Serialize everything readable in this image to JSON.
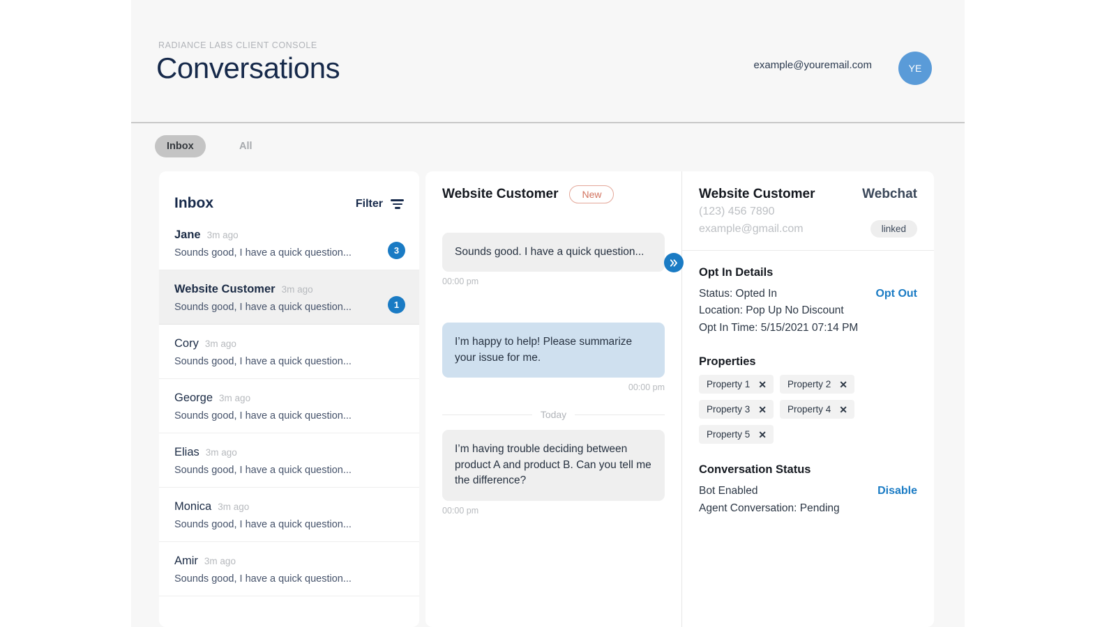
{
  "header": {
    "eyebrow": "RADIANCE LABS CLIENT CONSOLE",
    "title": "Conversations",
    "user_email": "example@youremail.com",
    "avatar_initials": "YE",
    "avatar_color": "#5a9bd8"
  },
  "tabs": [
    {
      "label": "Inbox",
      "active": true
    },
    {
      "label": "All",
      "active": false
    }
  ],
  "inbox": {
    "title": "Inbox",
    "filter_label": "Filter",
    "items": [
      {
        "name": "Jane",
        "time": "3m ago",
        "snippet": "Sounds good, I have a quick question...",
        "badge": "3",
        "unread": true,
        "selected": false
      },
      {
        "name": "Website Customer",
        "time": "3m ago",
        "snippet": "Sounds good, I have a quick question...",
        "badge": "1",
        "unread": true,
        "selected": true
      },
      {
        "name": "Cory",
        "time": "3m ago",
        "snippet": "Sounds good, I have a quick question...",
        "badge": "",
        "unread": false,
        "selected": false
      },
      {
        "name": "George",
        "time": "3m ago",
        "snippet": "Sounds good, I have a quick question...",
        "badge": "",
        "unread": false,
        "selected": false
      },
      {
        "name": "Elias",
        "time": "3m ago",
        "snippet": "Sounds good, I have a quick question...",
        "badge": "",
        "unread": false,
        "selected": false
      },
      {
        "name": "Monica",
        "time": "3m ago",
        "snippet": "Sounds good, I have a quick question...",
        "badge": "",
        "unread": false,
        "selected": false
      },
      {
        "name": "Amir",
        "time": "3m ago",
        "snippet": "Sounds good, I have a quick question...",
        "badge": "",
        "unread": false,
        "selected": false
      }
    ]
  },
  "chat": {
    "title": "Website Customer",
    "status_badge": "New",
    "day_separator": "Today",
    "collapse_icon": "double-chevron-right",
    "messages": [
      {
        "text": "Sounds good. I have a quick question...",
        "time": "00:00 pm",
        "direction": "incoming"
      },
      {
        "text": "I’m happy to help! Please summarize your issue for me.",
        "time": "00:00 pm",
        "direction": "outgoing"
      },
      {
        "text": "I’m having trouble deciding between product A and product B. Can you tell me the difference?",
        "time": "00:00 pm",
        "direction": "incoming"
      }
    ]
  },
  "details": {
    "name": "Website Customer",
    "channel": "Webchat",
    "phone": "(123) 456 7890",
    "email": "example@gmail.com",
    "linked_pill": "linked",
    "opt_in": {
      "heading": "Opt In Details",
      "status": "Status: Opted In",
      "action": "Opt Out",
      "location": "Location: Pop Up No Discount",
      "time": "Opt In Time: 5/15/2021 07:14 PM"
    },
    "properties": {
      "heading": "Properties",
      "tags": [
        "Property 1",
        "Property 2",
        "Property 3",
        "Property 4",
        "Property 5"
      ]
    },
    "conversation_status": {
      "heading": "Conversation Status",
      "bot": "Bot Enabled",
      "action": "Disable",
      "agent": "Agent Conversation: Pending"
    }
  },
  "colors": {
    "accent_blue": "#1a7bc4",
    "title_navy": "#16294a",
    "badge_new_text": "#d2735f",
    "outgoing_bubble": "#cfe0ef",
    "incoming_bubble": "#efefef"
  }
}
